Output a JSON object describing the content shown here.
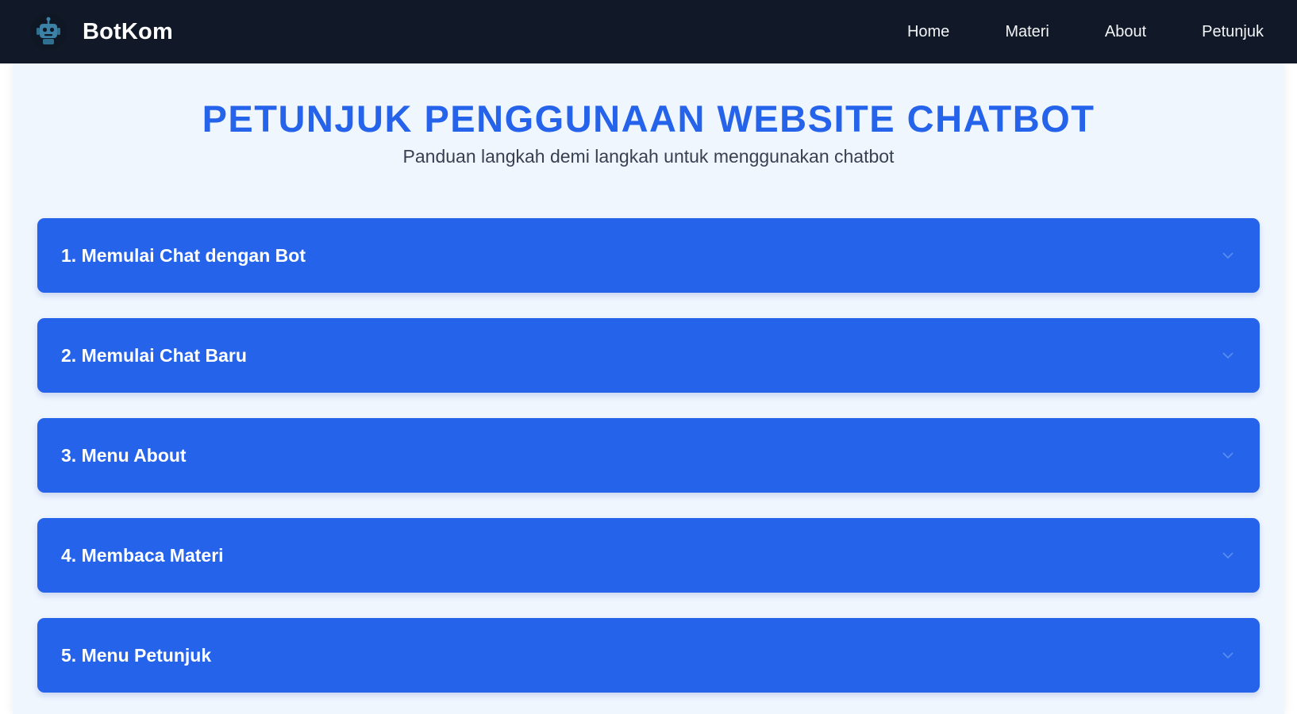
{
  "navbar": {
    "brand": "BotKom",
    "links": [
      "Home",
      "Materi",
      "About",
      "Petunjuk"
    ]
  },
  "page": {
    "title": "PETUNJUK PENGGUNAAN WEBSITE CHATBOT",
    "subtitle": "Panduan langkah demi langkah untuk menggunakan chatbot"
  },
  "accordion": {
    "items": [
      {
        "label": "1. Memulai Chat dengan Bot"
      },
      {
        "label": "2. Memulai Chat Baru"
      },
      {
        "label": "3. Menu About"
      },
      {
        "label": "4. Membaca Materi"
      },
      {
        "label": "5. Menu Petunjuk"
      }
    ]
  },
  "colors": {
    "navbar_bg": "#111827",
    "accent": "#2563eb",
    "panel_bg": "#f0f6fe",
    "subtitle_text": "#374151"
  },
  "icons": {
    "logo": "robot-icon",
    "accordion_toggle": "chevron-down-icon"
  }
}
